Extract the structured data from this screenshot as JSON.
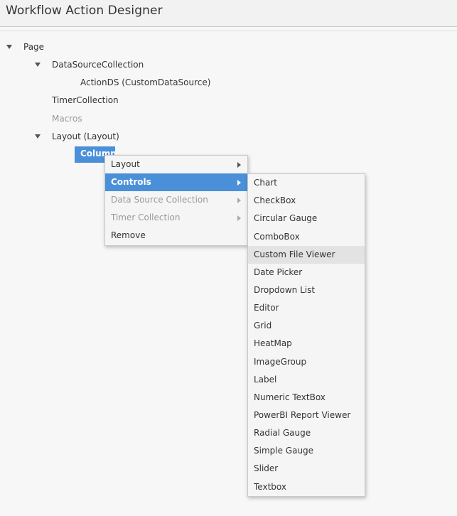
{
  "window": {
    "title": "Workflow Action Designer"
  },
  "tree": {
    "page": "Page",
    "data_source_collection": "DataSourceCollection",
    "action_ds": "ActionDS (CustomDataSource)",
    "timer_collection": "TimerCollection",
    "macros": "Macros",
    "layout": "Layout (Layout)",
    "column": "Column"
  },
  "context_menu": {
    "items": [
      {
        "label": "Layout"
      },
      {
        "label": "Controls"
      },
      {
        "label": "Data Source Collection"
      },
      {
        "label": "Timer Collection"
      },
      {
        "label": "Remove"
      }
    ]
  },
  "controls_submenu": {
    "items": [
      {
        "label": "Chart"
      },
      {
        "label": "CheckBox"
      },
      {
        "label": "Circular Gauge"
      },
      {
        "label": "ComboBox"
      },
      {
        "label": "Custom File Viewer"
      },
      {
        "label": "Date Picker"
      },
      {
        "label": "Dropdown List"
      },
      {
        "label": "Editor"
      },
      {
        "label": "Grid"
      },
      {
        "label": "HeatMap"
      },
      {
        "label": "ImageGroup"
      },
      {
        "label": "Label"
      },
      {
        "label": "Numeric TextBox"
      },
      {
        "label": "PowerBI Report Viewer"
      },
      {
        "label": "Radial Gauge"
      },
      {
        "label": "Simple Gauge"
      },
      {
        "label": "Slider"
      },
      {
        "label": "Textbox"
      }
    ]
  },
  "colors": {
    "accent": "#4a90d9",
    "hover": "#e3e3e3",
    "disabled_text": "#999999"
  }
}
